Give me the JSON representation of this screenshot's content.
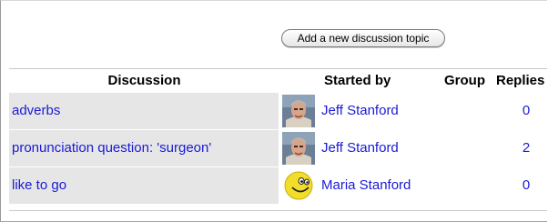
{
  "toolbar": {
    "add_topic_label": "Add a new discussion topic"
  },
  "table": {
    "headers": {
      "discussion": "Discussion",
      "started_by": "Started by",
      "group": "Group",
      "replies": "Replies"
    },
    "rows": [
      {
        "topic": "adverbs",
        "author": "Jeff Stanford",
        "avatar": "man-photo-icon",
        "replies": "0"
      },
      {
        "topic": "pronunciation question: 'surgeon'",
        "author": "Jeff Stanford",
        "avatar": "man-photo-icon",
        "replies": "2"
      },
      {
        "topic": "like to go",
        "author": "Maria Stanford",
        "avatar": "smiley-face-icon",
        "replies": "0"
      }
    ]
  },
  "colors": {
    "link": "#1a1ad6",
    "topic_cell_bg": "#e6e6e6",
    "smiley_yellow": "#f2dd2a"
  }
}
